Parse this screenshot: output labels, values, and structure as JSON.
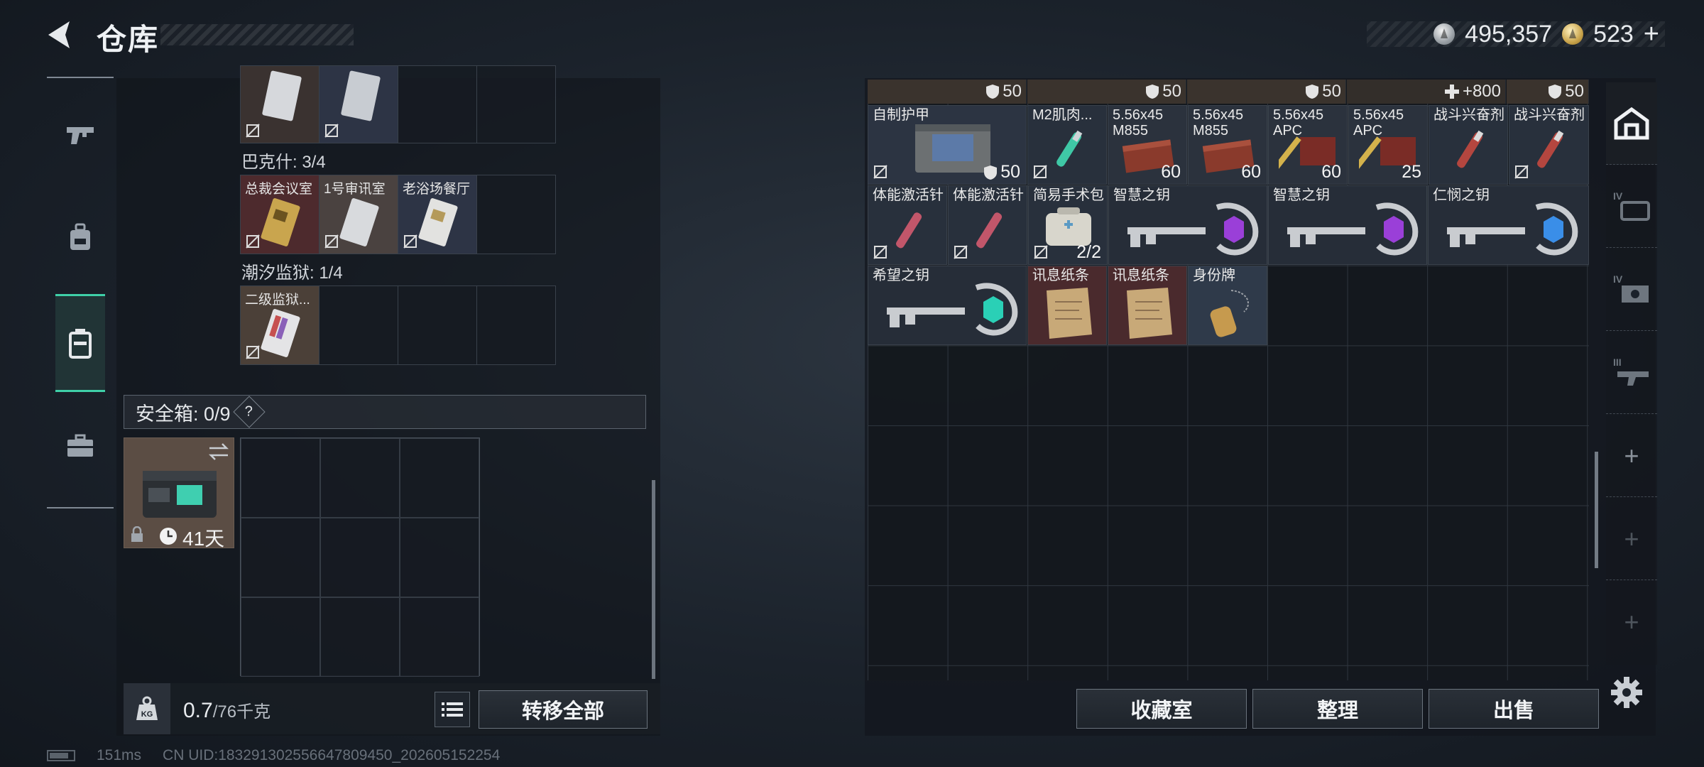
{
  "header": {
    "title": "仓库",
    "currency": {
      "silver": "495,357",
      "gold": "523"
    }
  },
  "side_nav": {
    "items": [
      {
        "icon": "pistol-icon"
      },
      {
        "icon": "backpack-icon"
      },
      {
        "icon": "container-icon",
        "active": true
      },
      {
        "icon": "briefcase-icon"
      }
    ]
  },
  "keys_section": {
    "row0": {
      "labels": [
        "",
        "",
        "",
        ""
      ]
    },
    "bakesh_label": "巴克什: 3/4",
    "bakesh": {
      "labels": [
        "总裁会议室",
        "1号审讯室",
        "老浴场餐厅",
        ""
      ]
    },
    "chaoxi_label": "潮汐监狱: 1/4",
    "chaoxi": {
      "labels": [
        "二级监狱...",
        "",
        "",
        ""
      ]
    }
  },
  "safebox": {
    "label": "安全箱: 0/9",
    "help": "?",
    "item_timer": "41天"
  },
  "weight": {
    "value": "0.7",
    "capacity": "/76千克"
  },
  "buttons": {
    "transfer_all": "转移全部",
    "collection": "收藏室",
    "sort": "整理",
    "sell": "出售"
  },
  "stash": {
    "top_strip": [
      "50",
      "50",
      "50",
      "+800",
      "50"
    ],
    "items": [
      {
        "label": "自制护甲",
        "count": "50"
      },
      {
        "label": "M2肌肉...",
        "count": ""
      },
      {
        "label": "5.56x45\nM855",
        "count": "60"
      },
      {
        "label": "5.56x45\nM855",
        "count": "60"
      },
      {
        "label": "5.56x45\nAPC",
        "count": "60"
      },
      {
        "label": "5.56x45\nAPC",
        "count": "25"
      },
      {
        "label": "战斗兴奋剂",
        "count": ""
      },
      {
        "label": "战斗兴奋剂",
        "count": ""
      },
      {
        "label": "体能激活针",
        "count": ""
      },
      {
        "label": "体能激活针",
        "count": ""
      },
      {
        "label": "简易手术包",
        "count": "2/2"
      },
      {
        "label": "智慧之钥",
        "count": ""
      },
      {
        "label": "智慧之钥",
        "count": ""
      },
      {
        "label": "仁悯之钥",
        "count": ""
      },
      {
        "label": "希望之钥",
        "count": ""
      },
      {
        "label": "讯息纸条",
        "count": ""
      },
      {
        "label": "讯息纸条",
        "count": ""
      },
      {
        "label": "身份牌",
        "count": ""
      }
    ]
  },
  "right_tabs": {
    "items": [
      {
        "icon": "warehouse-icon",
        "active": true
      },
      {
        "icon": "tier-iv-case-icon",
        "tier": "IV"
      },
      {
        "icon": "tier-iv-gear-icon",
        "tier": "IV"
      },
      {
        "icon": "tier-iii-weapon-icon",
        "tier": "III"
      },
      {
        "icon": "add-tab-icon",
        "symbol": "+"
      },
      {
        "icon": "add-tab-icon",
        "symbol": "+"
      },
      {
        "icon": "add-tab-icon",
        "symbol": "+"
      }
    ]
  },
  "status": {
    "ping": "151ms",
    "uid": "CN UID:183291302556647809450_202605152254"
  },
  "colors": {
    "accent_green": "#3fd0a8",
    "red_item_bg": "#4d2a2d",
    "blue_item_bg": "#2d3445",
    "grid_line": "#2f363f"
  }
}
